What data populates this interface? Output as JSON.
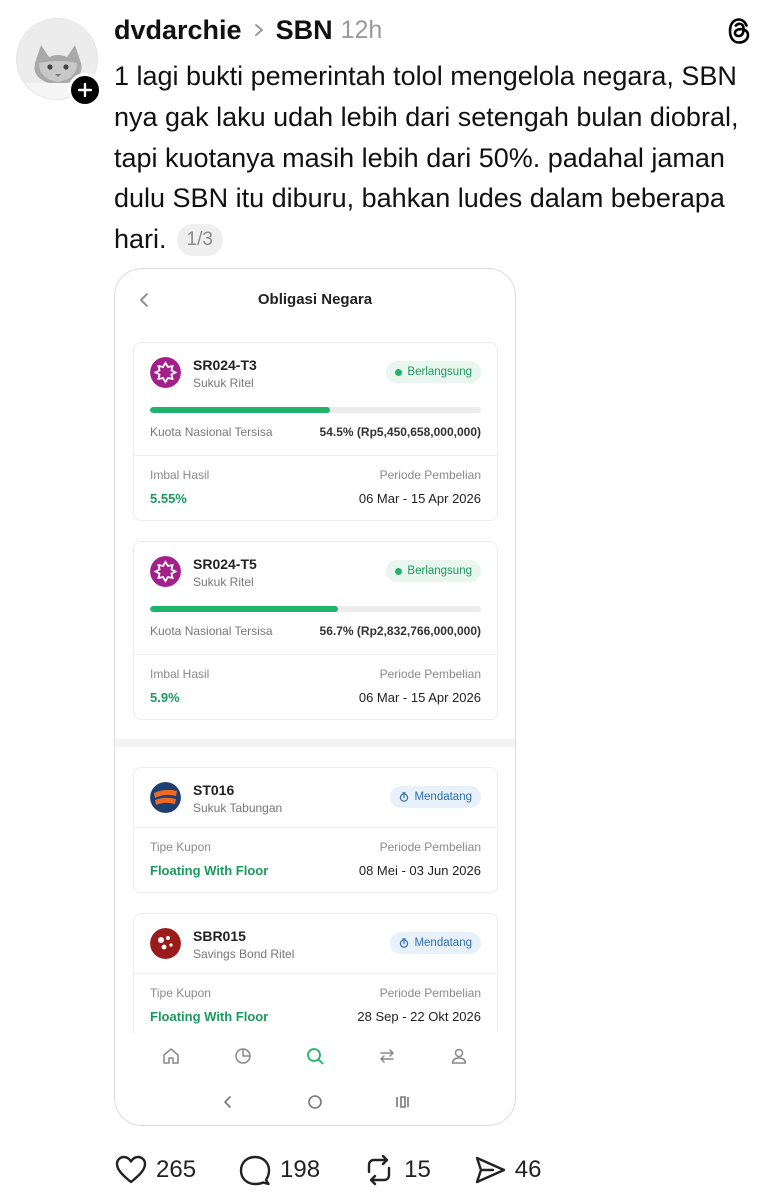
{
  "post": {
    "username": "dvdarchie",
    "topic": "SBN",
    "time": "12h",
    "text": "1 lagi bukti pemerintah tolol mengelola negara, SBN nya gak laku udah lebih dari setengah bulan diobral, tapi kuotanya masih lebih dari 50%. padahal jaman dulu SBN itu diburu, bahkan ludes dalam beberapa hari.",
    "page_indicator": "1/3"
  },
  "app": {
    "title": "Obligasi Negara",
    "bonds_active": [
      {
        "code": "SR024-T3",
        "type": "Sukuk Ritel",
        "status": "Berlangsung",
        "quota_label": "Kuota Nasional Tersisa",
        "quota_value": "54.5% (Rp5,450,658,000,000)",
        "quota_fraction": 0.545,
        "yield_label": "Imbal Hasil",
        "yield_value": "5.55%",
        "period_label": "Periode Pembelian",
        "period_value": "06 Mar - 15 Apr 2026",
        "logo_color": "#a3208b"
      },
      {
        "code": "SR024-T5",
        "type": "Sukuk Ritel",
        "status": "Berlangsung",
        "quota_label": "Kuota Nasional Tersisa",
        "quota_value": "56.7% (Rp2,832,766,000,000)",
        "quota_fraction": 0.567,
        "yield_label": "Imbal Hasil",
        "yield_value": "5.9%",
        "period_label": "Periode Pembelian",
        "period_value": "06 Mar - 15 Apr 2026",
        "logo_color": "#a3208b"
      }
    ],
    "bonds_upcoming": [
      {
        "code": "ST016",
        "type": "Sukuk Tabungan",
        "status": "Mendatang",
        "coupon_label": "Tipe Kupon",
        "coupon_value": "Floating With Floor",
        "period_label": "Periode Pembelian",
        "period_value": "08 Mei - 03 Jun 2026",
        "logo_color": "#f26a21"
      },
      {
        "code": "SBR015",
        "type": "Savings Bond Ritel",
        "status": "Mendatang",
        "coupon_label": "Tipe Kupon",
        "coupon_value": "Floating With Floor",
        "period_label": "Periode Pembelian",
        "period_value": "28 Sep - 22 Okt 2026",
        "logo_color": "#9b1b1b"
      }
    ],
    "nav_icons": [
      "home-icon",
      "portfolio-icon",
      "search-icon",
      "transaction-icon",
      "profile-icon"
    ],
    "accent_color": "#1fb46a"
  },
  "actions": {
    "likes": "265",
    "replies": "198",
    "reposts": "15",
    "shares": "46"
  }
}
